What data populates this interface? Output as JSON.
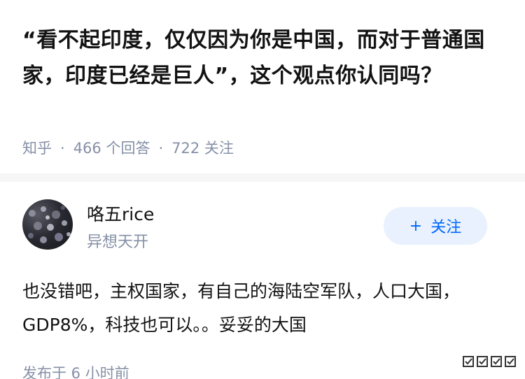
{
  "question": {
    "title": "“看不起印度，仅仅因为你是中国，而对于普通国家，印度已经是巨人”，这个观点你认同吗？",
    "source": "知乎",
    "answer_count": "466 个回答",
    "follower_count": "722 关注"
  },
  "answer": {
    "author_name": "咯五rice",
    "author_headline": "异想天开",
    "follow_label": "关注",
    "follow_icon": "plus-icon",
    "body": "也没错吧，主权国家，有自己的海陆空军队，人口大国，GDP8%，科技也可以。。妥妥的大国",
    "time": "发布于 6 小时前"
  },
  "colors": {
    "title": "#121212",
    "meta": "#8590a6",
    "accent": "#0066ff",
    "follow_bg": "#e8f1fd",
    "divider": "#f6f6f6"
  }
}
